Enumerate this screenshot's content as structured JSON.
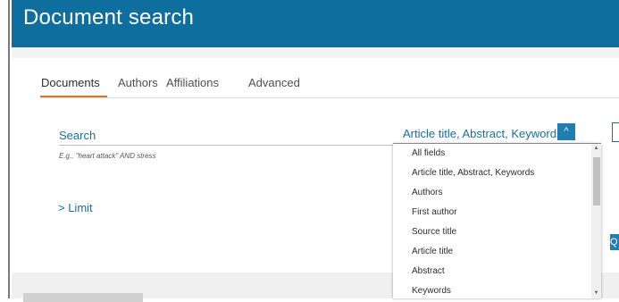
{
  "header": {
    "title": "Document search"
  },
  "tabs": [
    {
      "label": "Documents"
    },
    {
      "label": "Authors"
    },
    {
      "label": "Affiliations"
    },
    {
      "label": "Advanced"
    }
  ],
  "search": {
    "label": "Search",
    "hint": "E.g., \"heart attack\" AND stress",
    "limit_label": "> Limit"
  },
  "field_select": {
    "value": "Article title, Abstract, Keywords",
    "toggle_icon": "^",
    "options": [
      "All fields",
      "Article title, Abstract, Keywords",
      "Authors",
      "First author",
      "Source title",
      "Article title",
      "Abstract",
      "Keywords"
    ]
  },
  "scroll": {
    "up": "▲",
    "down": "▼"
  },
  "right_button": {
    "label": "Q"
  },
  "colors": {
    "brand": "#0e6f9e",
    "accent": "#e9711c",
    "link": "#1a6fa0"
  }
}
